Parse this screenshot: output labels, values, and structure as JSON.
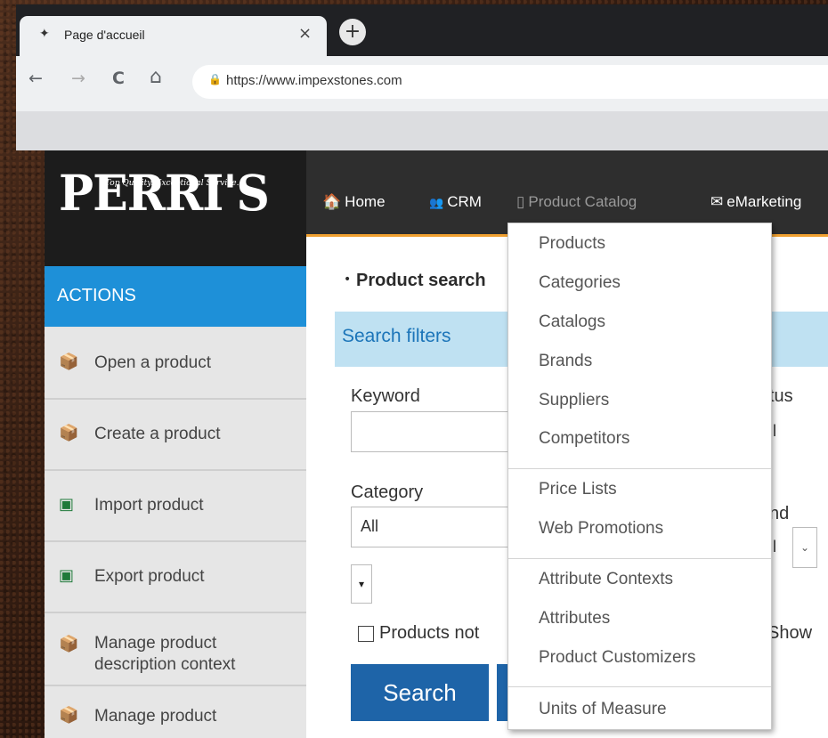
{
  "browser": {
    "tab_title": "Page d'accueil",
    "tab_close": "×",
    "new_tab": "+",
    "url": "https://www.impexstones.com",
    "nav": {
      "back": "←",
      "forward": "→",
      "reload": "C",
      "home": "⌂"
    }
  },
  "logo": {
    "text": "PERRI'S",
    "tagline": "Top Quality. Exceptional Service."
  },
  "topnav": {
    "home": "Home",
    "crm": "CRM",
    "product_catalog": "Product Catalog",
    "emarketing": "eMarketing"
  },
  "sidebar": {
    "title": "ACTIONS",
    "items": [
      {
        "label": "Open a product",
        "icon": "box-open-icon"
      },
      {
        "label": "Create a product",
        "icon": "box-add-icon"
      },
      {
        "label": "Import product",
        "icon": "excel-import-icon"
      },
      {
        "label": "Export product",
        "icon": "excel-export-icon"
      },
      {
        "label": "Manage product description context",
        "icon": "box-settings-icon"
      },
      {
        "label": "Manage product",
        "icon": "box-manage-icon"
      }
    ]
  },
  "main": {
    "title": "Product search",
    "filters_title": "Search filters",
    "keyword_label": "Keyword",
    "status_label": "tus",
    "status_value": "ll",
    "category_label": "Category",
    "category_value": "All",
    "brand_label": "nd",
    "brand_value": "ll",
    "small_select": "▾",
    "checkbox_label": "Products not",
    "show_label": "Show",
    "search_button": "Search"
  },
  "dropdown": {
    "groups": [
      [
        "Products",
        "Categories",
        "Catalogs",
        "Brands",
        "Suppliers",
        "Competitors"
      ],
      [
        "Price Lists",
        "Web Promotions"
      ],
      [
        "Attribute Contexts",
        "Attributes",
        "Product Customizers"
      ],
      [
        "Units of Measure"
      ]
    ]
  },
  "colors": {
    "accent_blue": "#1e90d8",
    "button_blue": "#1e64a8",
    "nav_bar": "#2e2e2e",
    "orange_rule": "#f0a030"
  }
}
